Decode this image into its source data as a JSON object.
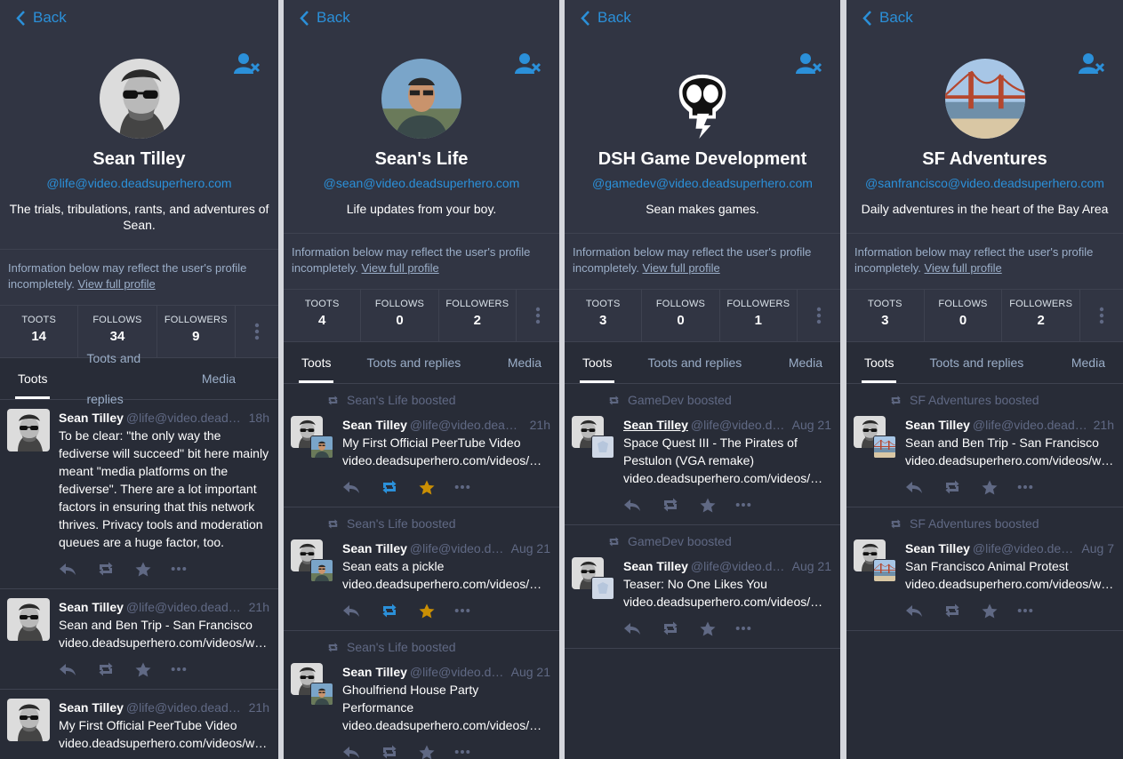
{
  "colors": {
    "accent": "#2b90d9",
    "bg": "#282c37",
    "header": "#313543",
    "muted": "#606984",
    "star": "#ca8f04"
  },
  "back_label": "Back",
  "info_text": "Information below may reflect the user's profile incompletely.",
  "info_link": "View full profile",
  "stat_labels": {
    "toots": "TOOTS",
    "follows": "FOLLOWS",
    "followers": "FOLLOWERS"
  },
  "tabs": {
    "toots": "Toots",
    "replies": "Toots and replies",
    "media": "Media"
  },
  "panels": [
    {
      "name": "Sean Tilley",
      "handle": "@life@video.deadsuperhero.com",
      "bio": "The trials, tribulations, rants, and adventures of Sean.",
      "toots": "14",
      "follows": "34",
      "followers": "9",
      "statuses": [
        {
          "name": "Sean Tilley",
          "handle": "@life@video.deadsuperhero.com",
          "time": "18h",
          "text": "To be clear: \"the only way the fediverse will succeed\" bit here mainly meant \"media platforms on the fediverse\". There are a lot important factors in ensuring that this network thrives. Privacy tools and moderation queues are a huge factor, too.",
          "url": ""
        },
        {
          "name": "Sean Tilley",
          "handle": "@life@video.deadsuperhero.com",
          "time": "21h",
          "text": "Sean and Ben Trip - San Francisco",
          "url": "video.deadsuperhero.com/videos/watch"
        },
        {
          "name": "Sean Tilley",
          "handle": "@life@video.deadsuperhero.com",
          "time": "21h",
          "text": "My First Official PeerTube Video",
          "url": "video.deadsuperhero.com/videos/watch"
        }
      ]
    },
    {
      "name": "Sean's Life",
      "handle": "@sean@video.deadsuperhero.com",
      "bio": "Life updates from your boy.",
      "toots": "4",
      "follows": "0",
      "followers": "2",
      "statuses": [
        {
          "boost": "Sean's Life boosted",
          "name": "Sean Tilley",
          "handle": "@life@video.deadsuperhero.com",
          "time": "21h",
          "text": "My First Official PeerTube Video",
          "url": "video.deadsuperhero.com/videos/watch"
        },
        {
          "boost": "Sean's Life boosted",
          "name": "Sean Tilley",
          "handle": "@life@video.deadsuperhero.com",
          "time": "Aug 21",
          "text": "Sean eats a pickle",
          "url": "video.deadsuperhero.com/videos/watch"
        },
        {
          "boost": "Sean's Life boosted",
          "name": "Sean Tilley",
          "handle": "@life@video.deadsuperhero.com",
          "time": "Aug 21",
          "text": "Ghoulfriend House Party Performance",
          "url": "video.deadsuperhero.com/videos/watch"
        }
      ]
    },
    {
      "name": "DSH Game Development",
      "handle": "@gamedev@video.deadsuperhero.com",
      "bio": "Sean makes games.",
      "toots": "3",
      "follows": "0",
      "followers": "1",
      "statuses": [
        {
          "boost": "GameDev boosted",
          "name": "Sean Tilley",
          "handle": "@life@video.deadsuperhero.com",
          "time": "Aug 21",
          "text": "Space Quest III - The Pirates of Pestulon (VGA remake)",
          "url": "video.deadsuperhero.com/videos/watch"
        },
        {
          "boost": "GameDev boosted",
          "name": "Sean Tilley",
          "handle": "@life@video.deadsuperhero.com",
          "time": "Aug 21",
          "text": "Teaser: No One Likes You",
          "url": "video.deadsuperhero.com/videos/watch"
        }
      ]
    },
    {
      "name": "SF Adventures",
      "handle": "@sanfrancisco@video.deadsuperhero.com",
      "bio": "Daily adventures in the heart of the Bay Area",
      "toots": "3",
      "follows": "0",
      "followers": "2",
      "statuses": [
        {
          "boost": "SF Adventures boosted",
          "name": "Sean Tilley",
          "handle": "@life@video.deadsuperhero.com",
          "time": "21h",
          "text": "Sean and Ben Trip - San Francisco",
          "url": "video.deadsuperhero.com/videos/watch"
        },
        {
          "boost": "SF Adventures boosted",
          "name": "Sean Tilley",
          "handle": "@life@video.deadsuperhero.com",
          "time": "Aug 7",
          "text": "San Francisco Animal Protest",
          "url": "video.deadsuperhero.com/videos/watch"
        }
      ]
    }
  ]
}
